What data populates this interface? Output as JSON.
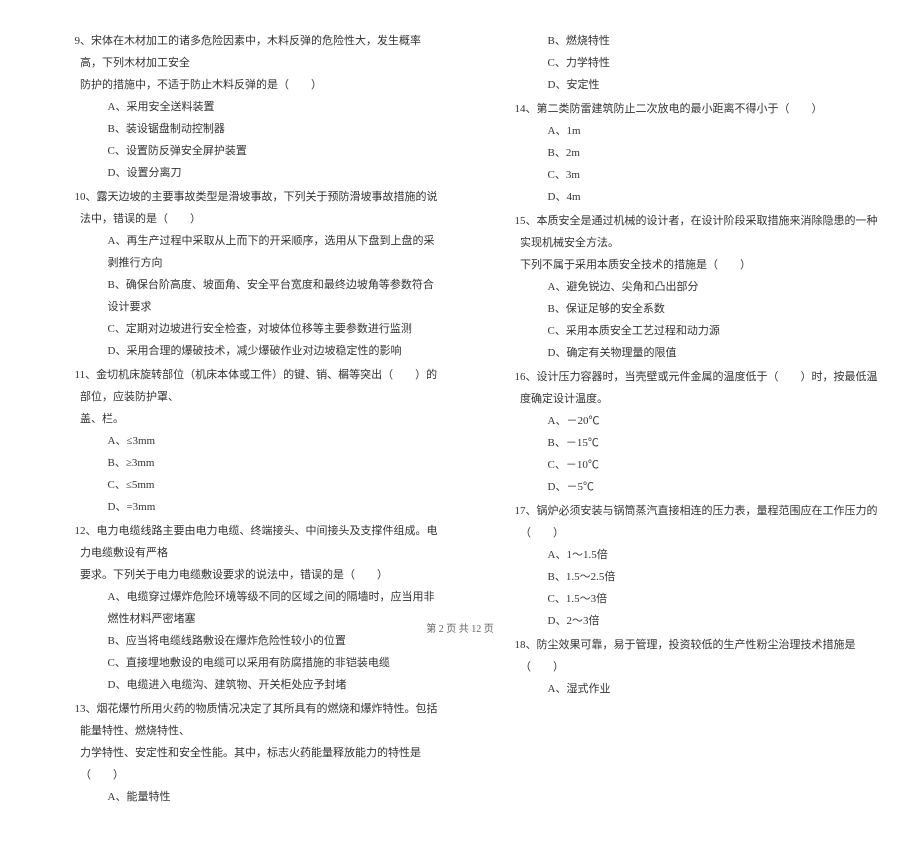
{
  "left_column": {
    "q9": {
      "text": "9、宋体在木材加工的诸多危险因素中，木料反弹的危险性大，发生概率高，下列木材加工安全",
      "cont": "防护的措施中，不适于防止木料反弹的是（　　）",
      "opt_a": "A、采用安全送料装置",
      "opt_b": "B、装设锯盘制动控制器",
      "opt_c": "C、设置防反弹安全屏护装置",
      "opt_d": "D、设置分离刀"
    },
    "q10": {
      "text": "10、露天边坡的主要事故类型是滑坡事故，下列关于预防滑坡事故措施的说法中，错误的是（　　）",
      "opt_a": "A、再生产过程中采取从上而下的开采顺序，选用从下盘到上盘的采剥推行方向",
      "opt_b": "B、确保台阶高度、坡面角、安全平台宽度和最终边坡角等参数符合设计要求",
      "opt_c": "C、定期对边坡进行安全检查，对坡体位移等主要参数进行监测",
      "opt_d": "D、采用合理的爆破技术，减少爆破作业对边坡稳定性的影响"
    },
    "q11": {
      "text": "11、金切机床旋转部位（机床本体或工件）的键、销、榍等突出（　　）的部位，应装防护罩、",
      "cont": "盖、栏。",
      "opt_a": "A、≤3mm",
      "opt_b": "B、≥3mm",
      "opt_c": "C、≤5mm",
      "opt_d": "D、=3mm"
    },
    "q12": {
      "text": "12、电力电缆线路主要由电力电缆、终端接头、中间接头及支撑件组成。电力电缆敷设有严格",
      "cont": "要求。下列关于电力电缆敷设要求的说法中，错误的是（　　）",
      "opt_a": "A、电缆穿过爆炸危险环境等级不同的区域之间的隔墙时，应当用非燃性材料严密堵塞",
      "opt_b": "B、应当将电缆线路敷设在爆炸危险性较小的位置",
      "opt_c": "C、直接埋地敷设的电缆可以采用有防腐措施的非铠装电缆",
      "opt_d": "D、电缆进入电缆沟、建筑物、开关柜处应予封堵"
    },
    "q13": {
      "text": "13、烟花爆竹所用火药的物质情况决定了其所具有的燃烧和爆炸特性。包括能量特性、燃烧特性、",
      "cont": "力学特性、安定性和安全性能。其中，标志火药能量释放能力的特性是（　　）",
      "opt_a": "A、能量特性"
    }
  },
  "right_column": {
    "q13_cont": {
      "opt_b": "B、燃烧特性",
      "opt_c": "C、力学特性",
      "opt_d": "D、安定性"
    },
    "q14": {
      "text": "14、第二类防雷建筑防止二次放电的最小距离不得小于（　　）",
      "opt_a": "A、1m",
      "opt_b": "B、2m",
      "opt_c": "C、3m",
      "opt_d": "D、4m"
    },
    "q15": {
      "text": "15、本质安全是通过机械的设计者，在设计阶段采取措施来消除隐患的一种实现机械安全方法。",
      "cont": "下列不属于采用本质安全技术的措施是（　　）",
      "opt_a": "A、避免锐边、尖角和凸出部分",
      "opt_b": "B、保证足够的安全系数",
      "opt_c": "C、采用本质安全工艺过程和动力源",
      "opt_d": "D、确定有关物理量的限值"
    },
    "q16": {
      "text": "16、设计压力容器时，当壳壁或元件金属的温度低于（　　）时，按最低温度确定设计温度。",
      "opt_a": "A、－20℃",
      "opt_b": "B、－15℃",
      "opt_c": "C、－10℃",
      "opt_d": "D、－5℃"
    },
    "q17": {
      "text": "17、锅炉必须安装与锅筒蒸汽直接相连的压力表，量程范围应在工作压力的（　　）",
      "opt_a": "A、1～1.5倍",
      "opt_b": "B、1.5～2.5倍",
      "opt_c": "C、1.5～3倍",
      "opt_d": "D、2～3倍"
    },
    "q18": {
      "text": "18、防尘效果可靠，易于管理，投资较低的生产性粉尘治理技术措施是（　　）",
      "opt_a": "A、湿式作业"
    }
  },
  "footer": "第 2 页 共 12 页"
}
